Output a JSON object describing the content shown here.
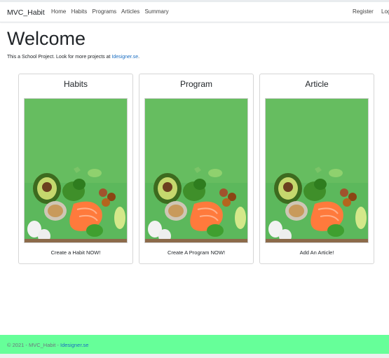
{
  "navbar": {
    "brand": "MVC_Habit",
    "links": [
      "Home",
      "Habits",
      "Programs",
      "Articles",
      "Summary"
    ],
    "right_links": [
      "Register",
      "Log"
    ]
  },
  "main": {
    "title": "Welcome",
    "intro_text": "This a School Project. Look for more projects at ",
    "intro_link": "Idesigner.se",
    "intro_end": "."
  },
  "cards": [
    {
      "title": "Habits",
      "text": "Create a Habit NOW!"
    },
    {
      "title": "Program",
      "text": "Create A Program NOW!"
    },
    {
      "title": "Article",
      "text": "Add An Article!"
    }
  ],
  "footer": {
    "text": "© 2021 - MVC_Habit - ",
    "link": "Idesigner.se"
  },
  "colors": {
    "footer_bg": "#66ff99",
    "link": "#1b6ec2",
    "card_image_bg": "#5cb85c"
  }
}
